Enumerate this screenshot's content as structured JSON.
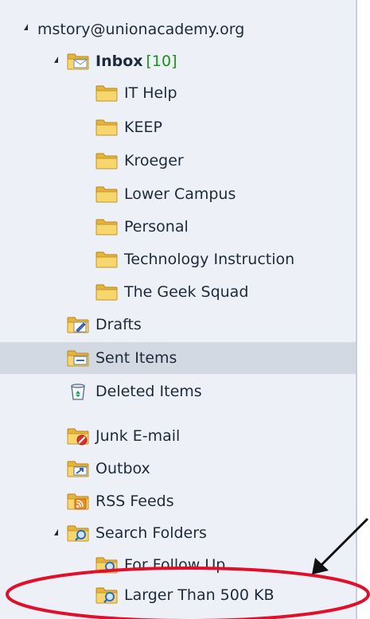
{
  "account": {
    "label": "mstory@unionacademy.org"
  },
  "inbox": {
    "label": "Inbox",
    "count": "[10]"
  },
  "inbox_folders": [
    {
      "label": "IT Help"
    },
    {
      "label": "KEEP"
    },
    {
      "label": "Kroeger"
    },
    {
      "label": "Lower Campus"
    },
    {
      "label": "Personal"
    },
    {
      "label": "Technology Instruction"
    },
    {
      "label": "The Geek Squad"
    }
  ],
  "drafts": {
    "label": "Drafts"
  },
  "sent_items": {
    "label": "Sent Items"
  },
  "deleted_items": {
    "label": "Deleted Items"
  },
  "junk_email": {
    "label": "Junk E-mail"
  },
  "outbox": {
    "label": "Outbox"
  },
  "rss_feeds": {
    "label": "RSS Feeds"
  },
  "search_folders": {
    "label": "Search Folders",
    "items": [
      {
        "label": "For Follow Up"
      },
      {
        "label": "Larger Than 500 KB"
      }
    ]
  },
  "colors": {
    "pane_bg": "#edf1f7",
    "selected_bg": "#d3d9e3",
    "folder_yellow": "#f3c64c",
    "count_green": "#1a8f1a",
    "annotation_red": "#e0102a"
  }
}
